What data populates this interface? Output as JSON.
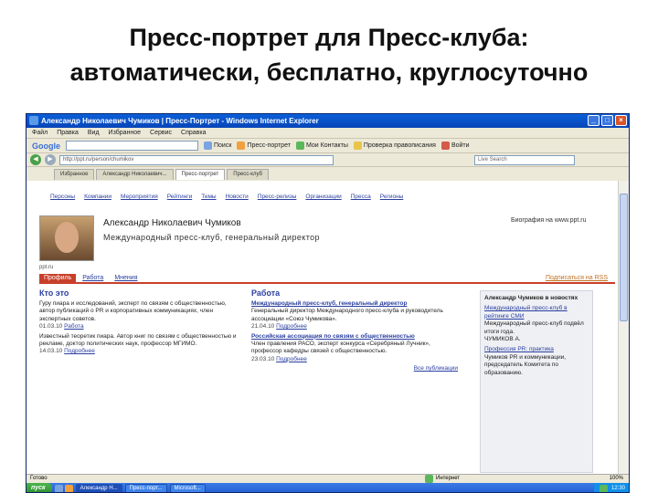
{
  "slide": {
    "title_line1": "Пресс-портрет для Пресс-клуба:",
    "title_line2": "автоматически, бесплатно, круглосуточно"
  },
  "browser": {
    "window_title": "Александр Николаевич Чумиков | Пресс-Портрет - Windows Internet Explorer",
    "menu": [
      "Файл",
      "Правка",
      "Вид",
      "Избранное",
      "Сервис",
      "Справка"
    ],
    "toolbar": {
      "google_logo": "Google",
      "search_btn": "Поиск",
      "item1": "Пресс-портрет",
      "item2": "Мои Контакты",
      "item3": "Проверка правописания",
      "item4": "Войти"
    },
    "address": "http://ppt.ru/person/chumikov",
    "search_box": "Live Search",
    "tabs": [
      "Избранное",
      "Александр Николаевич...",
      "Пресс-портрет",
      "Пресс-клуб"
    ],
    "status": "Готово",
    "zone": "Интернет",
    "zoom": "100%",
    "taskbar": {
      "start": "пуск",
      "tasks": [
        "Александр Н...",
        "Пресс-порт...",
        "Microsoft..."
      ],
      "tray_time": "12:30"
    },
    "colors": {
      "title_bar": "#0a5fd8",
      "link": "#2a3fa0",
      "accent": "#c8402a"
    }
  },
  "page": {
    "topnav": [
      "Персоны",
      "Компании",
      "Мероприятия",
      "Рейтинги",
      "Темы",
      "Новости",
      "Пресс-релизы",
      "Организации",
      "Пресса",
      "Регионы"
    ],
    "person_name": "Александр Николаевич Чумиков",
    "person_role": "Международный пресс-клуб, генеральный директор",
    "photo_link": "Биография на www.ppt.ru",
    "mini_caption": "ppt.ru",
    "profile_tabs": [
      "Профиль",
      "Работа",
      "Мнения"
    ],
    "subscribe": "Подписаться на RSS",
    "col1": {
      "heading": "Кто это",
      "items": [
        {
          "text": "Гуру пиара и исследований, эксперт по связям с общественностью, автор публикаций о PR и корпоративных коммуникациях, член экспертных советов.",
          "date": "01.03.10",
          "link": "Работа"
        },
        {
          "text": "Известный теоретик пиара. Автор книг по связям с общественностью и рекламе, доктор политических наук, профессор МГИМО.",
          "date": "14.03.10",
          "link": "Подробнее"
        }
      ]
    },
    "col2": {
      "heading": "Работа",
      "items": [
        {
          "title": "Международный пресс-клуб, генеральный директор",
          "text": "Генеральный директор Международного пресс-клуба и руководитель ассоциации «Союз Чумикова».",
          "date": "21.04.10",
          "link": "Подробнее"
        },
        {
          "title": "Российская ассоциация по связям с общественностью",
          "text": "Член правления РАСО, эксперт конкурса «Серебряный Лучник», профессор кафедры связей с общественностью.",
          "date": "23.03.10",
          "link": "Подробнее"
        }
      ],
      "more": "Все публикации"
    },
    "sidebar": {
      "heading": "Александр Чумиков в новостях",
      "items": [
        {
          "link": "Международный пресс-клуб в рейтинге СМИ",
          "text": "Международный пресс-клуб подвёл итоги года.",
          "author": "ЧУМИКОВ А."
        },
        {
          "link": "Профессия PR: практика",
          "text": "Чумиков PR и коммуникации, председатель Комитета по образованию."
        }
      ]
    }
  }
}
